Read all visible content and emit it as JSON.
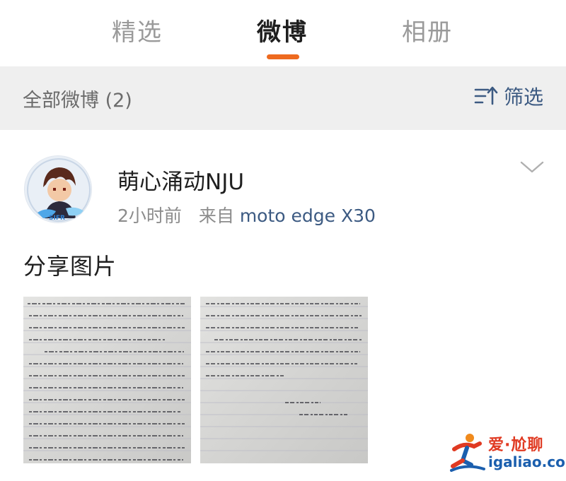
{
  "tabs": [
    {
      "label": "精选",
      "active": false
    },
    {
      "label": "微博",
      "active": true
    },
    {
      "label": "相册",
      "active": false
    }
  ],
  "filter_bar": {
    "count_label": "全部微博 (2)",
    "filter_label": "筛选",
    "filter_icon": "sort-filter-icon"
  },
  "post": {
    "username": "萌心涌动NJU",
    "time": "2小时前",
    "from_label": "来自",
    "source": "moto edge X30",
    "text": "分享图片",
    "more_icon": "chevron-down-icon",
    "photos": [
      {
        "name": "handwritten-letter-photo-1"
      },
      {
        "name": "handwritten-letter-photo-2"
      }
    ]
  },
  "watermark": {
    "title": "爱·尬聊",
    "url": "igaliao.com"
  },
  "colors": {
    "accent": "#ee6a1f",
    "link": "#3c5a82",
    "filter_bar_bg": "#efefef",
    "watermark_red": "#e03a22",
    "watermark_blue": "#1b5fae"
  }
}
